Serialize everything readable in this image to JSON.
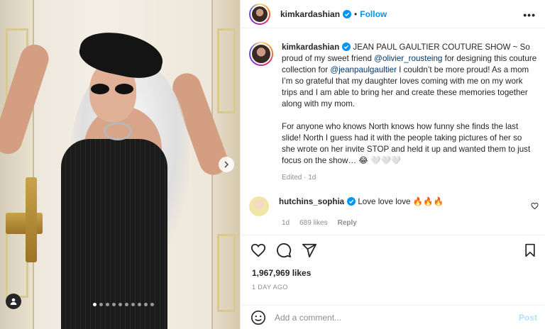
{
  "post": {
    "media": {
      "carousel_total": 10,
      "carousel_active": 0
    },
    "header": {
      "username": "kimkardashian",
      "separator": "•",
      "follow_label": "Follow",
      "more_label": "•••"
    },
    "caption": {
      "username": "kimkardashian",
      "text_1": " JEAN PAUL GAULTIER COUTURE SHOW ~ So proud of my sweet friend ",
      "mention_1": "@olivier_rousteing",
      "text_2": " for designing this couture collection for ",
      "mention_2": "@jeanpaulgaultier",
      "text_3": " I couldn’t be more proud! As a mom I’m so grateful that my daughter loves coming with me on my work trips and I am able to bring her and create these memories together along with my mom.",
      "text_4": "For anyone who knows North knows how funny she finds the last slide! North I guess had it with the people taking pictures of her so she wrote on her invite STOP and held it up and wanted them to just focus on the show… 😂 ",
      "text_5": "🤍🤍🤍",
      "meta": "Edited · 1d"
    },
    "comment": {
      "username": "hutchins_sophia",
      "text": "Love love love ",
      "emoji": "🔥🔥🔥",
      "age": "1d",
      "likes": "689 likes",
      "reply_label": "Reply"
    },
    "stats": {
      "likes": "1,967,969 likes",
      "time": "1 DAY AGO"
    },
    "add_comment": {
      "placeholder": "Add a comment...",
      "post_label": "Post"
    },
    "colors": {
      "accent": "#0095f6",
      "verified": "#0095f6",
      "mention": "#00376b",
      "muted": "#8e8e8e"
    }
  }
}
